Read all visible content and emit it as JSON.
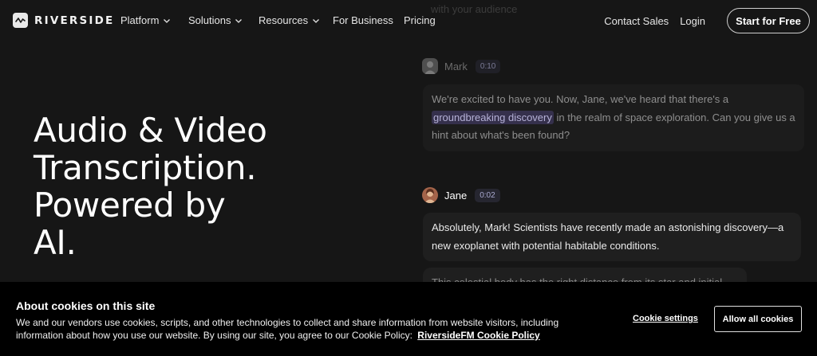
{
  "brand": {
    "name": "RIVERSIDE"
  },
  "nav": {
    "links": [
      {
        "label": "Platform",
        "dropdown": true
      },
      {
        "label": "Solutions",
        "dropdown": true
      },
      {
        "label": "Resources",
        "dropdown": true
      },
      {
        "label": "For Business",
        "dropdown": false
      },
      {
        "label": "Pricing",
        "dropdown": false
      }
    ],
    "contact_sales": "Contact Sales",
    "login": "Login",
    "start_label": "Start for Free"
  },
  "hero": {
    "title_lines": [
      "Audio & Video",
      "Transcription.",
      "Powered by",
      "AI."
    ]
  },
  "transcript": {
    "faded_top": "with your audience",
    "messages": [
      {
        "speaker": "Mark",
        "time": "0:10",
        "text_before": "We're excited to have you. Now, Jane, we've heard that there's a",
        "highlight": "groundbreaking discovery",
        "text_after": " in the realm of space exploration. Can you give us a hint about what's been found?"
      },
      {
        "speaker": "Jane",
        "time": "0:02",
        "text": "Absolutely, Mark! Scientists have recently made an astonishing discovery—a new exoplanet with potential habitable conditions."
      },
      {
        "partial_text": "This celestial body has the right distance from its star and initial"
      }
    ]
  },
  "cookie": {
    "title": "About cookies on this site",
    "text": "We and our vendors use cookies, scripts, and other technologies to collect and share information from website visitors, including information about how you use our website. By using our site, you agree to our Cookie Policy:",
    "policy_link": "RiversideFM Cookie Policy",
    "settings_label": "Cookie settings",
    "allow_label": "Allow all cookies"
  },
  "colors": {
    "background": "#161616",
    "bubble": "#1f1f1f",
    "highlight_bg": "#35304c",
    "badge_text": "#a9a9d0",
    "banner": "#000000"
  },
  "icons": {
    "logo": "waveform-logo-icon",
    "dropdown": "chevron-down-icon"
  }
}
